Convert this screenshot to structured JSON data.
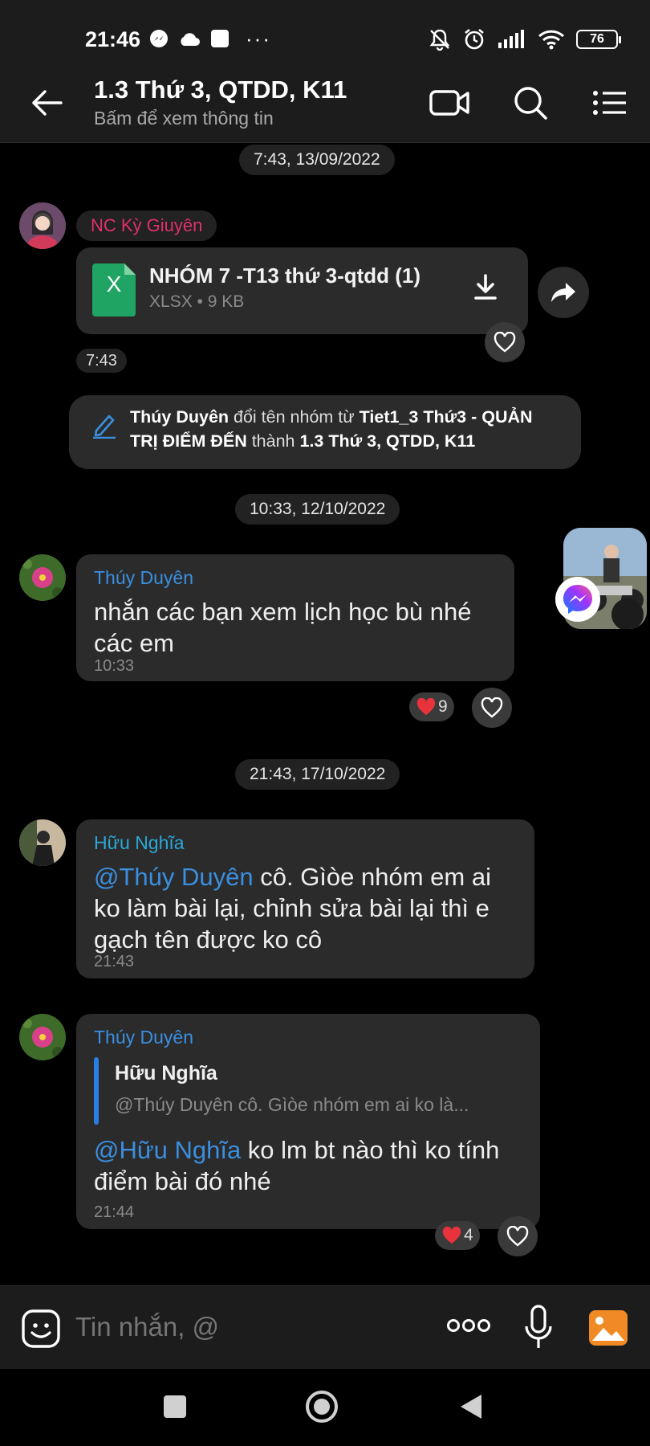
{
  "status_bar": {
    "time": "21:46",
    "battery": "76"
  },
  "header": {
    "title": "1.3 Thứ 3, QTDD, K11",
    "subtitle": "Bấm để xem thông tin"
  },
  "date_separators": [
    "7:43, 13/09/2022",
    "10:33, 12/10/2022",
    "21:43, 17/10/2022"
  ],
  "messages": [
    {
      "sender": "NC Kỳ Giuyên",
      "file": {
        "name": "NHÓM 7 -T13 thứ 3-qtdd (1)",
        "meta": "XLSX • 9 KB",
        "icon_letter": "X"
      },
      "time": "7:43"
    },
    {
      "type": "system",
      "actor": "Thúy Duyên",
      "action": " đổi tên nhóm từ ",
      "old_name": "Tiet1_3 Thứ3 - QUẢN TRỊ ĐIỂM ĐẾN",
      "connector": " thành ",
      "new_name": "1.3 Thứ 3, QTDD, K11"
    },
    {
      "sender": "Thúy Duyên",
      "text": "nhắn các bạn xem lịch học bù nhé các em",
      "time": "10:33",
      "reaction_count": "9"
    },
    {
      "sender": "Hữu Nghĩa",
      "mention": "@Thúy Duyên",
      "text": " cô.  Gìòe nhóm em ai ko làm bài lại, chỉnh sửa bài lại thì e gạch tên được ko cô",
      "time": "21:43"
    },
    {
      "sender": "Thúy Duyên",
      "quote_author": "Hữu Nghĩa",
      "quote_text": "@Thúy Duyên cô.  Gìòe nhóm em ai ko là...",
      "mention": "@Hữu Nghĩa",
      "text": " ko lm bt nào thì ko tính điểm bài đó nhé",
      "time": "21:44",
      "reaction_count": "4"
    }
  ],
  "input": {
    "placeholder": "Tin nhắn, @"
  },
  "colors": {
    "accent": "#3a8fe0",
    "sender_pink": "#e0306a",
    "excel_green": "#1fa463",
    "heart": "#e8333c"
  }
}
